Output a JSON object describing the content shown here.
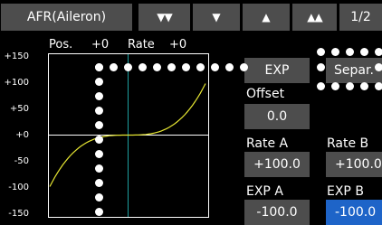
{
  "header": {
    "title": "AFR(Aileron)",
    "page": "1/2",
    "buttons": [
      {
        "name": "double-down-button",
        "glyph": "▼▼"
      },
      {
        "name": "down-button",
        "glyph": "▼"
      },
      {
        "name": "up-button",
        "glyph": "▲"
      },
      {
        "name": "double-up-button",
        "glyph": "▲▲"
      }
    ]
  },
  "graph": {
    "pos_label": "Pos.",
    "pos_value": "+0",
    "rate_label": "Rate",
    "rate_value": "+0",
    "y_ticks": [
      "+150",
      "+100",
      "+50",
      "+0",
      "-50",
      "-100",
      "-150"
    ],
    "curve_color": "#e6e632",
    "center_line_color": "#1ea0a0"
  },
  "controls": {
    "exp_button": "EXP",
    "separ_button": "Separ.",
    "offset_label": "Offset",
    "offset_value": "0.0",
    "rate_a_label": "Rate A",
    "rate_a_value": "+100.0",
    "rate_b_label": "Rate B",
    "rate_b_value": "+100.0",
    "exp_a_label": "EXP A",
    "exp_a_value": "-100.0",
    "exp_b_label": "EXP B",
    "exp_b_value": "-100.0"
  }
}
